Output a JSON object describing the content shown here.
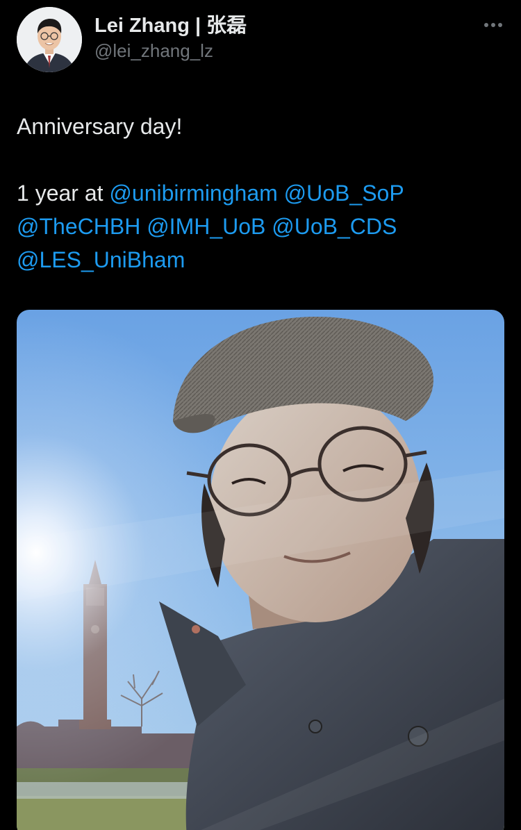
{
  "author": {
    "display_name": "Lei Zhang | 张磊",
    "handle": "@lei_zhang_lz",
    "avatar_icon": "profile-photo"
  },
  "more_icon": "more-horizontal-icon",
  "tweet": {
    "line1": "Anniversary day!",
    "line2_prefix": "1 year at",
    "mentions": [
      "@unibirmingham",
      "@UoB_SoP",
      "@TheCHBH",
      "@IMH_UoB",
      "@UoB_CDS",
      "@LES_UniBham"
    ]
  },
  "media": {
    "type": "photo",
    "icon": "selfie-photo"
  },
  "colors": {
    "background": "#000000",
    "text": "#e7e9ea",
    "muted": "#71767b",
    "link": "#1d9bf0"
  }
}
